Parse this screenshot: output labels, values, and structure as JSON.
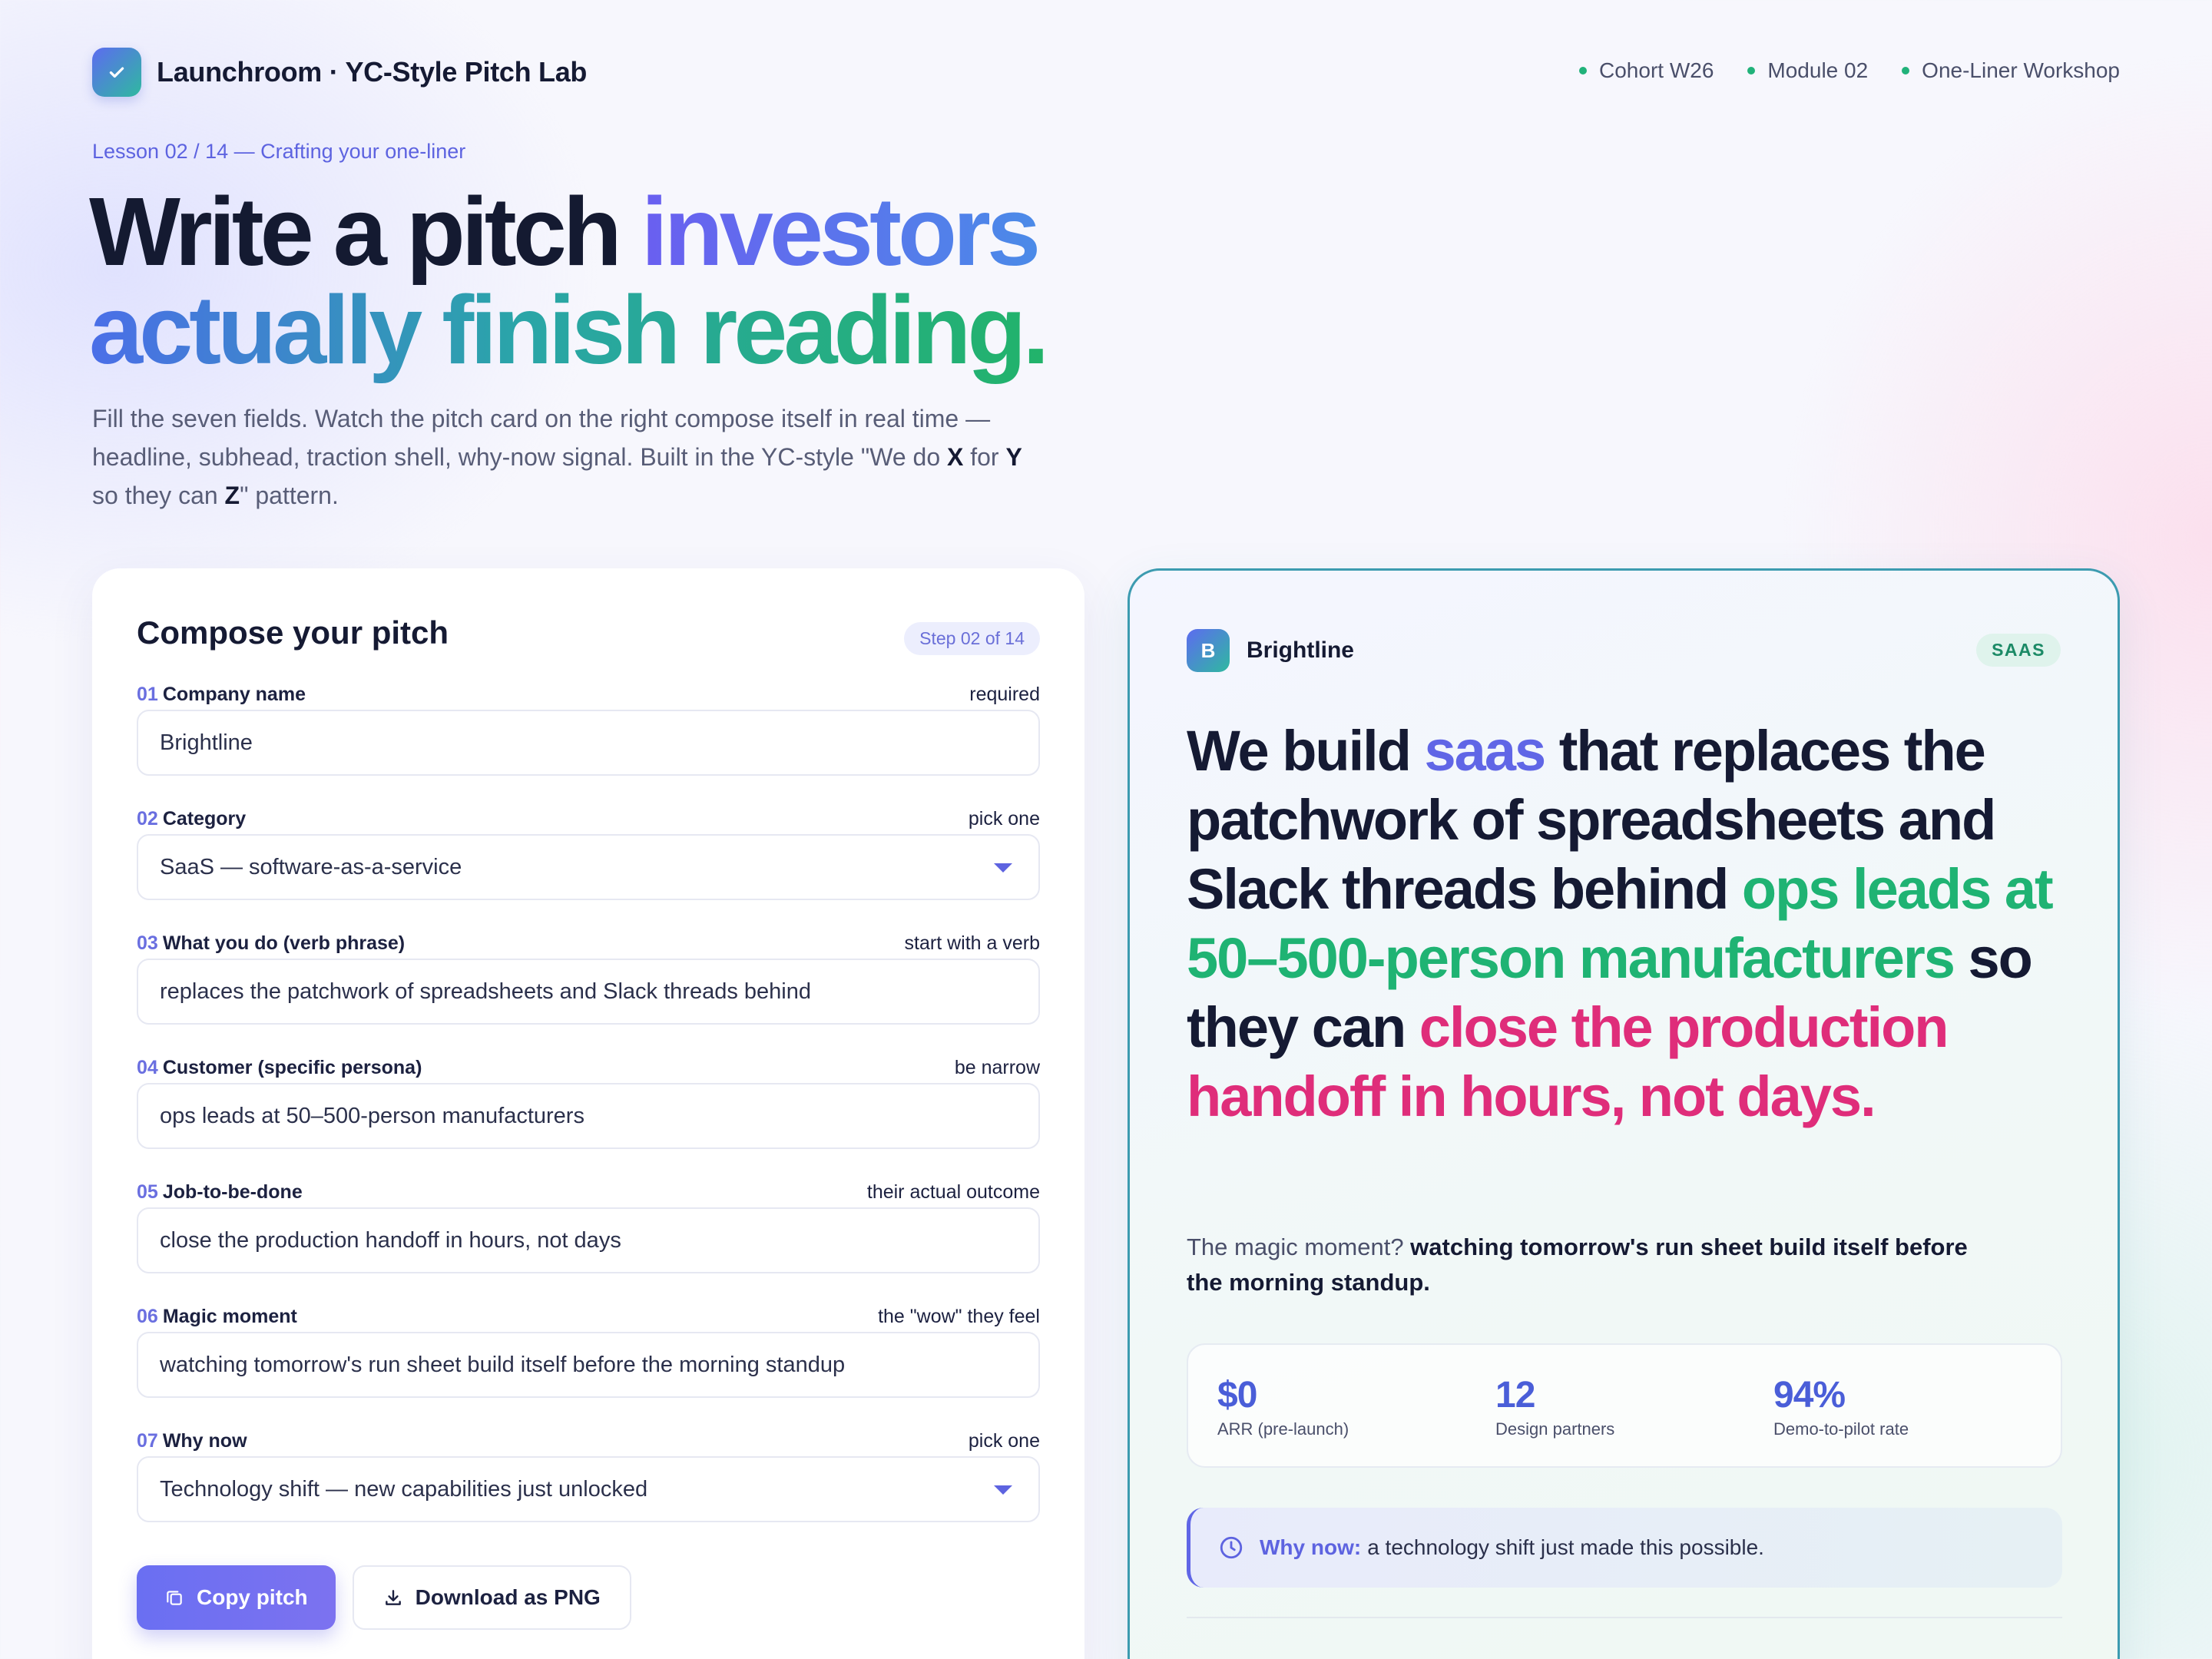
{
  "brand": {
    "mark_icon": "check-icon",
    "name": "Launchroom · YC-Style Pitch Lab"
  },
  "nav": {
    "pills": [
      "Cohort W26",
      "Module 02",
      "One-Liner Workshop"
    ],
    "dot_color": "#21b27a"
  },
  "hero": {
    "eyebrow": "Lesson 02 / 14 — Crafting your one-liner",
    "title_part1": "Write a pitch ",
    "title_part2": "investors",
    "title_part3": "actually finish reading.",
    "sub_1": "Fill the seven fields. Watch the pitch card on the right compose itself in real time — headline, subhead, traction shell, why-now signal. Built in the YC-style \"We do ",
    "sub_x": "X",
    "sub_2": " for ",
    "sub_y": "Y",
    "sub_3": " so they can ",
    "sub_z": "Z",
    "sub_4": "\" pattern."
  },
  "form": {
    "title": "Compose your pitch",
    "step": "Step 02 of 14",
    "fields": [
      {
        "num": "01",
        "label": "Company name",
        "hint": "required",
        "value": "Brightline"
      },
      {
        "num": "02",
        "label": "Category",
        "hint": "pick one",
        "value": "SaaS — software-as-a-service"
      },
      {
        "num": "03",
        "label": "What you do (verb phrase)",
        "hint": "start with a verb",
        "value": "replaces the patchwork of spreadsheets and Slack threads behind"
      },
      {
        "num": "04",
        "label": "Customer (specific persona)",
        "hint": "be narrow",
        "value": "ops leads at 50–500-person manufacturers"
      },
      {
        "num": "05",
        "label": "Job-to-be-done",
        "hint": "their actual outcome",
        "value": "close the production handoff in hours, not days"
      },
      {
        "num": "06",
        "label": "Magic moment",
        "hint": "the \"wow\" they feel",
        "value": "watching tomorrow's run sheet build itself before the morning standup"
      },
      {
        "num": "07",
        "label": "Why now",
        "hint": "pick one",
        "value": "Technology shift — new capabilities just unlocked"
      }
    ],
    "copy_button": "Copy pitch",
    "download_button": "Download as PNG"
  },
  "preview": {
    "logo_letter": "B",
    "company": "Brightline",
    "tag": "SAAS",
    "headline": {
      "we_build": "We build ",
      "category": "saas",
      "verb": " that replaces the patchwork of spreadsheets and Slack threads behind ",
      "customer": "ops leads at 50–500-person manufacturers",
      "so_they_can": " so they can ",
      "job": "close the production handoff in hours, not days",
      "period": "."
    },
    "magic_prefix": "The magic moment? ",
    "magic_text": "watching tomorrow's run sheet build itself before the morning standup.",
    "stats": [
      {
        "value": "$0",
        "label": "ARR (pre-launch)"
      },
      {
        "value": "12",
        "label": "Design partners"
      },
      {
        "value": "94%",
        "label": "Demo-to-pilot rate"
      }
    ],
    "why_now_label": "Why now:",
    "why_now_text": "a technology shift just made this possible."
  },
  "colors": {
    "accent": "#6066e6",
    "customer_highlight": "#1fb373",
    "job_highlight": "#df2d7a",
    "preview_border": "#3c9bb0"
  }
}
